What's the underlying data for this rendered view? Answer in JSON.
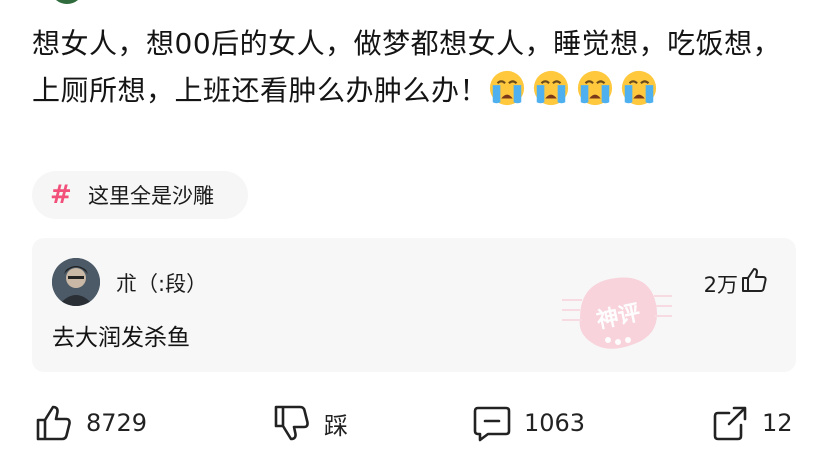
{
  "post": {
    "text": "想女人，想00后的女人，做梦都想女人，睡觉想，吃饭想，上厕所想，上班还看肿么办肿么办！",
    "emojis": [
      "loudly-crying-face",
      "loudly-crying-face",
      "loudly-crying-face",
      "loudly-crying-face"
    ]
  },
  "topic": {
    "hash": "#",
    "label": "这里全是沙雕",
    "hash_color": "#f2507a"
  },
  "hot_comment": {
    "username": "朮（:段）",
    "likes": "2万",
    "text": "去大润发杀鱼",
    "stamp_text": "神评",
    "stamp_color": "#f7b6c6"
  },
  "actions": {
    "like_count": "8729",
    "dislike_label": "踩",
    "comment_count": "1063",
    "share_count": "12"
  }
}
